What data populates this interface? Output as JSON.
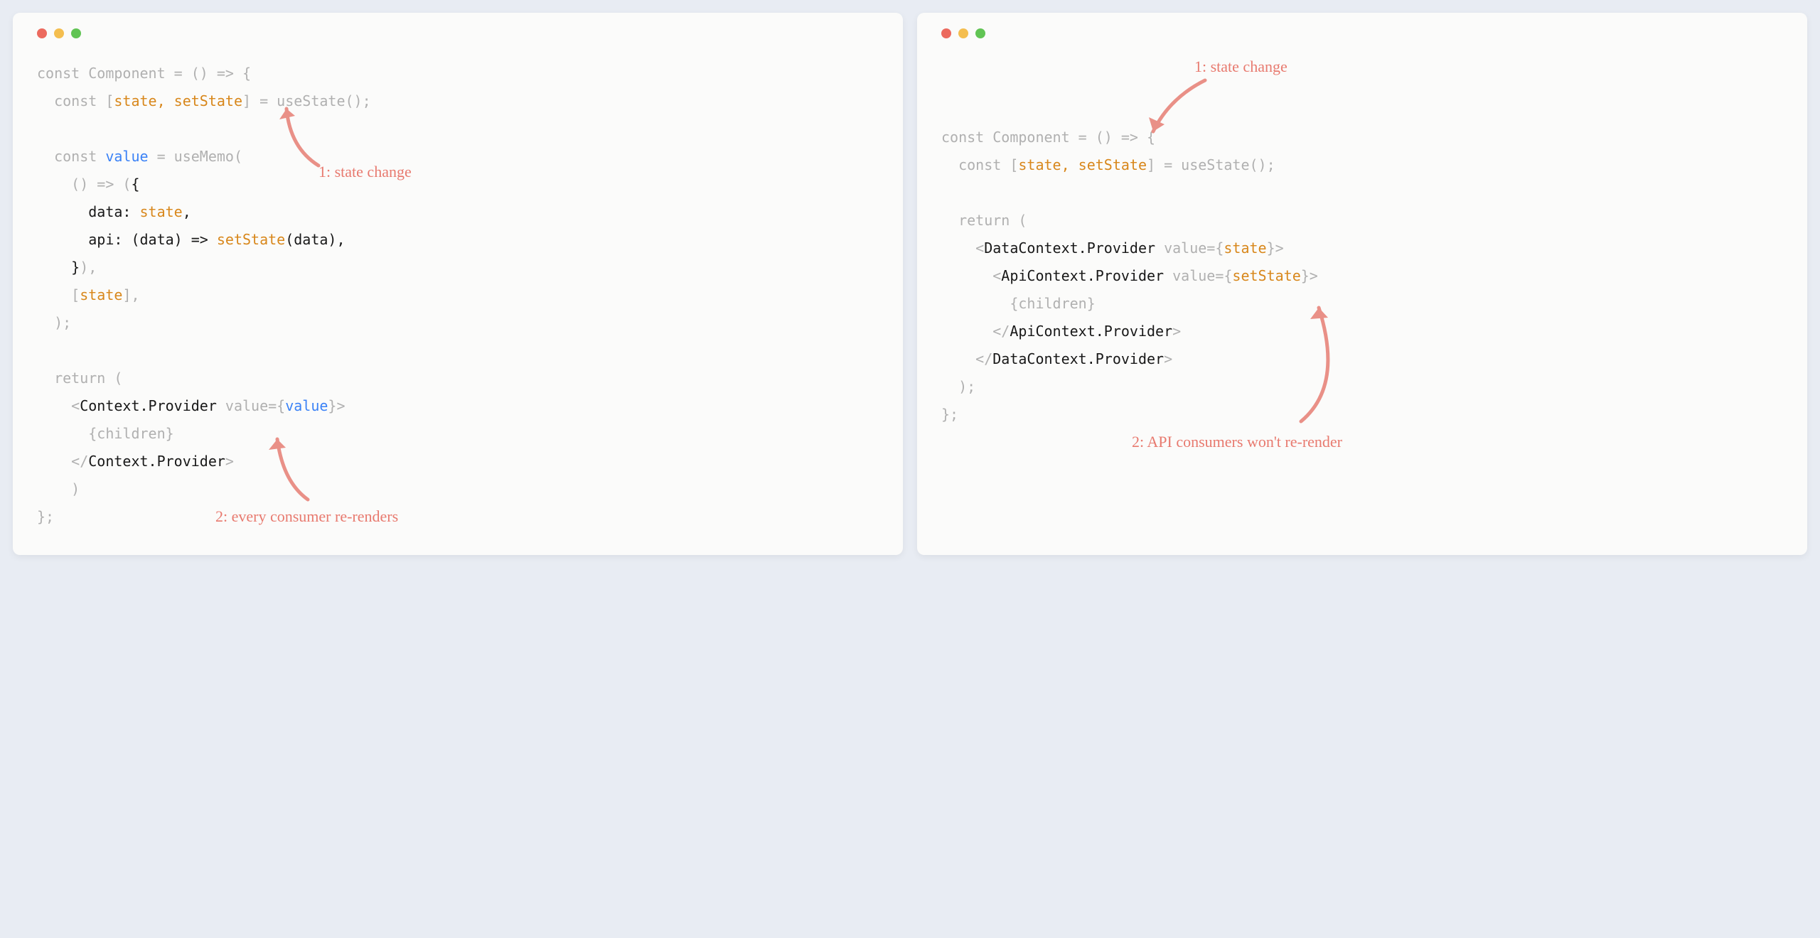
{
  "left": {
    "annotations": {
      "a1": "1: state change",
      "a2": "2: every consumer re-renders"
    },
    "code": [
      {
        "t": "const Component = () => {",
        "c": "dim"
      },
      {
        "segments": [
          {
            "t": "  const [",
            "c": "dim"
          },
          {
            "t": "state, setState",
            "c": "hl"
          },
          {
            "t": "] = useState();",
            "c": "dim"
          }
        ]
      },
      {
        "t": "",
        "c": ""
      },
      {
        "segments": [
          {
            "t": "  const ",
            "c": "dim"
          },
          {
            "t": "value",
            "c": "blue"
          },
          {
            "t": " = useMemo(",
            "c": "dim"
          }
        ]
      },
      {
        "segments": [
          {
            "t": "    () => (",
            "c": "dim"
          },
          {
            "t": "{",
            "c": ""
          }
        ]
      },
      {
        "segments": [
          {
            "t": "      data: ",
            "c": ""
          },
          {
            "t": "state",
            "c": "hl"
          },
          {
            "t": ",",
            "c": ""
          }
        ]
      },
      {
        "segments": [
          {
            "t": "      api: (data) => ",
            "c": ""
          },
          {
            "t": "setState",
            "c": "hl"
          },
          {
            "t": "(data),",
            "c": ""
          }
        ]
      },
      {
        "segments": [
          {
            "t": "    }",
            "c": ""
          },
          {
            "t": "),",
            "c": "dim"
          }
        ]
      },
      {
        "segments": [
          {
            "t": "    [",
            "c": "dim"
          },
          {
            "t": "state",
            "c": "hl"
          },
          {
            "t": "],",
            "c": "dim"
          }
        ]
      },
      {
        "t": "  );",
        "c": "dim"
      },
      {
        "t": "",
        "c": ""
      },
      {
        "t": "  return (",
        "c": "dim"
      },
      {
        "segments": [
          {
            "t": "    <",
            "c": "dim"
          },
          {
            "t": "Context.Provider",
            "c": ""
          },
          {
            "t": " value={",
            "c": "dim"
          },
          {
            "t": "value",
            "c": "blue"
          },
          {
            "t": "}>",
            "c": "dim"
          }
        ]
      },
      {
        "t": "      {children}",
        "c": "dim"
      },
      {
        "segments": [
          {
            "t": "    </",
            "c": "dim"
          },
          {
            "t": "Context.Provider",
            "c": ""
          },
          {
            "t": ">",
            "c": "dim"
          }
        ]
      },
      {
        "t": "    )",
        "c": "dim"
      },
      {
        "t": "};",
        "c": "dim"
      }
    ]
  },
  "right": {
    "annotations": {
      "a1": "1: state change",
      "a2": "2: API consumers won't re-render"
    },
    "code": [
      {
        "t": "const Component = () => {",
        "c": "dim"
      },
      {
        "segments": [
          {
            "t": "  const [",
            "c": "dim"
          },
          {
            "t": "state, setState",
            "c": "hl"
          },
          {
            "t": "] = useState();",
            "c": "dim"
          }
        ]
      },
      {
        "t": "",
        "c": ""
      },
      {
        "t": "  return (",
        "c": "dim"
      },
      {
        "segments": [
          {
            "t": "    <",
            "c": "dim"
          },
          {
            "t": "DataContext.Provider",
            "c": ""
          },
          {
            "t": " value={",
            "c": "dim"
          },
          {
            "t": "state",
            "c": "hl"
          },
          {
            "t": "}>",
            "c": "dim"
          }
        ]
      },
      {
        "segments": [
          {
            "t": "      <",
            "c": "dim"
          },
          {
            "t": "ApiContext.Provider",
            "c": ""
          },
          {
            "t": " value={",
            "c": "dim"
          },
          {
            "t": "setState",
            "c": "hl"
          },
          {
            "t": "}>",
            "c": "dim"
          }
        ]
      },
      {
        "t": "        {children}",
        "c": "dim"
      },
      {
        "segments": [
          {
            "t": "      </",
            "c": "dim"
          },
          {
            "t": "ApiContext.Provider",
            "c": ""
          },
          {
            "t": ">",
            "c": "dim"
          }
        ]
      },
      {
        "segments": [
          {
            "t": "    </",
            "c": "dim"
          },
          {
            "t": "DataContext.Provider",
            "c": ""
          },
          {
            "t": ">",
            "c": "dim"
          }
        ]
      },
      {
        "t": "  );",
        "c": "dim"
      },
      {
        "t": "};",
        "c": "dim"
      }
    ]
  }
}
